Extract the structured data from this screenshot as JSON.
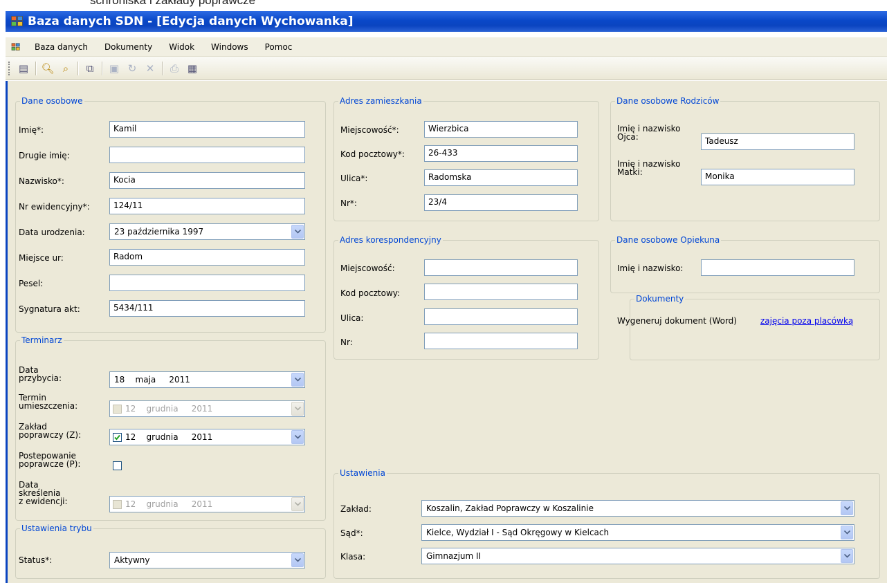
{
  "caption_fragment": "schroniska i zakłady poprawcze",
  "window": {
    "title": "Baza danych SDN - [Edycja danych Wychowanka]"
  },
  "menu": [
    "Baza danych",
    "Dokumenty",
    "Widok",
    "Windows",
    "Pomoc"
  ],
  "toolbar_icons": [
    "new-icon",
    "find-icon",
    "find-next-icon",
    "copy-icon",
    "save-icon",
    "undo-icon",
    "delete-icon",
    "print-icon",
    "word-icon"
  ],
  "dane_osobowe": {
    "title": "Dane osobowe",
    "imie": {
      "label": "Imię*:",
      "value": "Kamil"
    },
    "drugie_imie": {
      "label": "Drugie imię:",
      "value": ""
    },
    "nazwisko": {
      "label": "Nazwisko*:",
      "value": "Kocia"
    },
    "nr_ewidencyjny": {
      "label": "Nr ewidencyjny*:",
      "value": "124/11"
    },
    "data_urodzenia": {
      "label": "Data urodzenia:",
      "value": "23 października 1997"
    },
    "miejsce_ur": {
      "label": "Miejsce ur:",
      "value": "Radom"
    },
    "pesel": {
      "label": "Pesel:",
      "value": ""
    },
    "sygnatura": {
      "label": "Sygnatura akt:",
      "value": "5434/111"
    }
  },
  "terminarz": {
    "title": "Terminarz",
    "data_przybycia": {
      "label1": "Data",
      "label2": "przybycia:",
      "day": "18",
      "month": "maja",
      "year": "2011"
    },
    "termin_umieszczenia": {
      "label1": "Termin",
      "label2": "umieszczenia:",
      "day": "12",
      "month": "grudnia",
      "year": "2011",
      "checked": false,
      "enabled": false
    },
    "zaklad_poprawczy": {
      "label1": "Zakład",
      "label2": "poprawczy (Z):",
      "day": "12",
      "month": "grudnia",
      "year": "2011",
      "checked": true,
      "enabled": true
    },
    "postepowanie": {
      "label1": "Postepowanie",
      "label2": "poprawcze (P):",
      "checked": false
    },
    "data_skreslenia": {
      "label1": "Data",
      "label2": "skreślenia",
      "label3": "z ewidencji:",
      "day": "12",
      "month": "grudnia",
      "year": "2011",
      "checked": false,
      "enabled": false
    }
  },
  "ustawienia_trybu": {
    "title": "Ustawienia trybu",
    "status": {
      "label": "Status*:",
      "value": "Aktywny"
    }
  },
  "adres_zamieszkania": {
    "title": "Adres zamieszkania",
    "miejscowosc": {
      "label": "Miejscowość*:",
      "value": "Wierzbica"
    },
    "kod": {
      "label": "Kod pocztowy*:",
      "value": "26-433"
    },
    "ulica": {
      "label": "Ulica*:",
      "value": "Radomska"
    },
    "nr": {
      "label": "Nr*:",
      "value": "23/4"
    }
  },
  "adres_korespondencyjny": {
    "title": "Adres korespondencyjny",
    "miejscowosc": {
      "label": "Miejscowość:",
      "value": ""
    },
    "kod": {
      "label": "Kod pocztowy:",
      "value": ""
    },
    "ulica": {
      "label": "Ulica:",
      "value": ""
    },
    "nr": {
      "label": "Nr:",
      "value": ""
    }
  },
  "rodzice": {
    "title": "Dane osobowe Rodziców",
    "ojciec": {
      "label1": "Imię i nazwisko",
      "label2": "Ojca:",
      "value": "Tadeusz"
    },
    "matka": {
      "label1": "Imię i nazwisko",
      "label2": "Matki:",
      "value": "Monika"
    }
  },
  "opiekun": {
    "title": "Dane osobowe Opiekuna",
    "imie": {
      "label": "Imię i nazwisko:",
      "value": ""
    }
  },
  "dokumenty": {
    "title": "Dokumenty",
    "text": "Wygeneruj dokument (Word)",
    "link": "zajęcia poza placówką"
  },
  "ustawienia": {
    "title": "Ustawienia",
    "zaklad": {
      "label": "Zakład:",
      "value": "Koszalin, Zakład Poprawczy w Koszalinie"
    },
    "sad": {
      "label": "Sąd*:",
      "value": "Kielce, Wydział I - Sąd Okręgowy w Kielcach"
    },
    "klasa": {
      "label": "Klasa:",
      "value": "Gimnazjum II"
    }
  }
}
